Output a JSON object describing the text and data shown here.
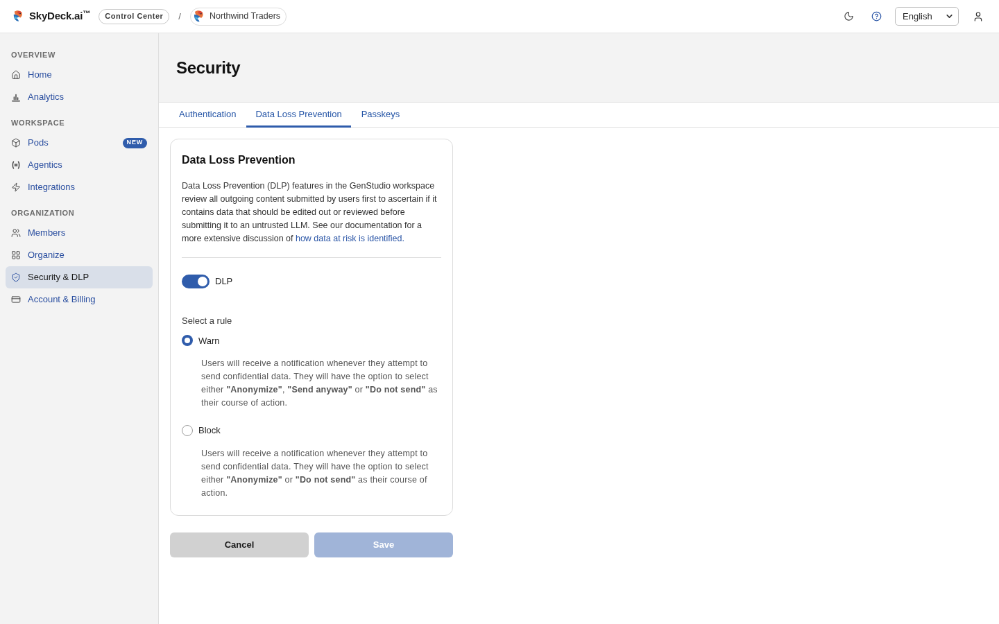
{
  "header": {
    "brand": "SkyDeck.ai$^{™}$",
    "console_label": "Control Center",
    "separator": "/",
    "organization": "Northwind Traders",
    "language": "English"
  },
  "sidebar": {
    "sections": [
      {
        "heading": "OVERVIEW",
        "items": [
          {
            "label": "Home",
            "selected": false
          },
          {
            "label": "Analytics",
            "selected": false
          }
        ]
      },
      {
        "heading": "WORKSPACE",
        "items": [
          {
            "label": "Pods",
            "selected": false,
            "badge": "NEW"
          },
          {
            "label": "Agentics",
            "selected": false
          },
          {
            "label": "Integrations",
            "selected": false
          }
        ]
      },
      {
        "heading": "ORGANIZATION",
        "items": [
          {
            "label": "Members",
            "selected": false
          },
          {
            "label": "Organize",
            "selected": false
          },
          {
            "label": "Security & DLP",
            "selected": true
          },
          {
            "label": "Account & Billing",
            "selected": false
          }
        ]
      }
    ]
  },
  "main": {
    "title": "Security",
    "tabs": [
      {
        "label": "Authentication",
        "selected": false
      },
      {
        "label": "Data Loss Prevention",
        "selected": true
      },
      {
        "label": "Passkeys",
        "selected": false
      }
    ],
    "card": {
      "title": "Data Loss Prevention",
      "description": [
        {
          "kind": "text",
          "text": "Data Loss Prevention (DLP) features in the GenStudio workspace review all outgoing content submitted by users first to ascertain if it contains data that should be edited out or reviewed before submitting it to an untrusted LLM. See our documentation for a more extensive discussion of "
        },
        {
          "kind": "link",
          "text": "how data at risk is identified."
        }
      ],
      "toggle": {
        "label": "DLP",
        "on": true
      },
      "rule_label": "Select a rule",
      "rules": [
        {
          "label": "Warn",
          "selected": true,
          "description": "Users will receive a notification whenever they attempt to send confidential data. They will have the option to select either **\"Anonymize\"**, **\"Send anyway\"** or **\"Do not send\"** as their course of action."
        },
        {
          "label": "Block",
          "selected": false,
          "description": "Users will receive a notification whenever they attempt to send confidential data. They will have the option to select either **\"Anonymize\"** or **\"Do not send\"** as their course of action."
        }
      ]
    },
    "buttons": [
      {
        "label": "Cancel",
        "kind": "secondary",
        "disabled": false
      },
      {
        "label": "Save",
        "kind": "primary",
        "disabled": true
      }
    ]
  }
}
